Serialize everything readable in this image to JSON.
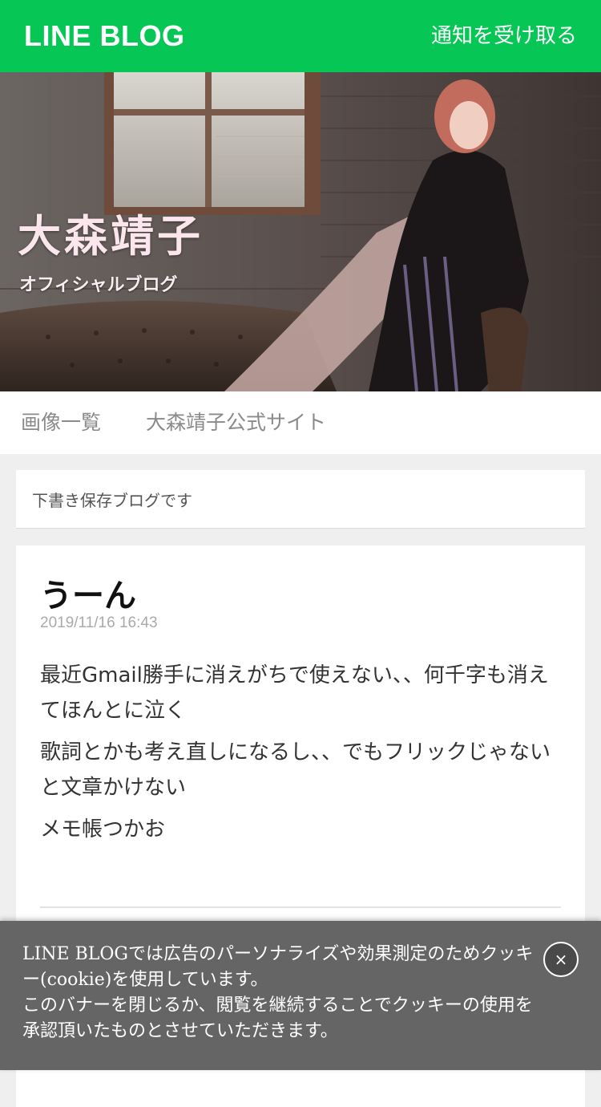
{
  "header": {
    "logo": "LINE BLOG",
    "notify_label": "通知を受け取る"
  },
  "hero": {
    "title": "大森靖子",
    "subtitle": "オフィシャルブログ"
  },
  "subnav": {
    "items": [
      {
        "label": "画像一覧"
      },
      {
        "label": "大森靖子公式サイト"
      }
    ]
  },
  "notice": {
    "text": "下書き保存ブログです"
  },
  "post": {
    "title": "うーん",
    "date": "2019/11/16 16:43",
    "paragraphs": [
      "最近Gmail勝手に消えがちで使えない、、何千字も消えてほんとに泣く",
      "歌詞とかも考え直しになるし、、でもフリックじゃないと文章かけない",
      "メモ帳つかお"
    ]
  },
  "cookie_banner": {
    "line1": "LINE BLOGでは広告のパーソナライズや効果測定のためクッキー(cookie)を使用しています。",
    "line2": "このバナーを閉じるか、閲覧を継続することでクッキーの使用を承認頂いたものとさせていただきます。",
    "close_label": "×"
  },
  "colors": {
    "brand": "#06c755",
    "banner_bg": "#5f5f5f"
  },
  "icons": {
    "close": "close-icon"
  }
}
